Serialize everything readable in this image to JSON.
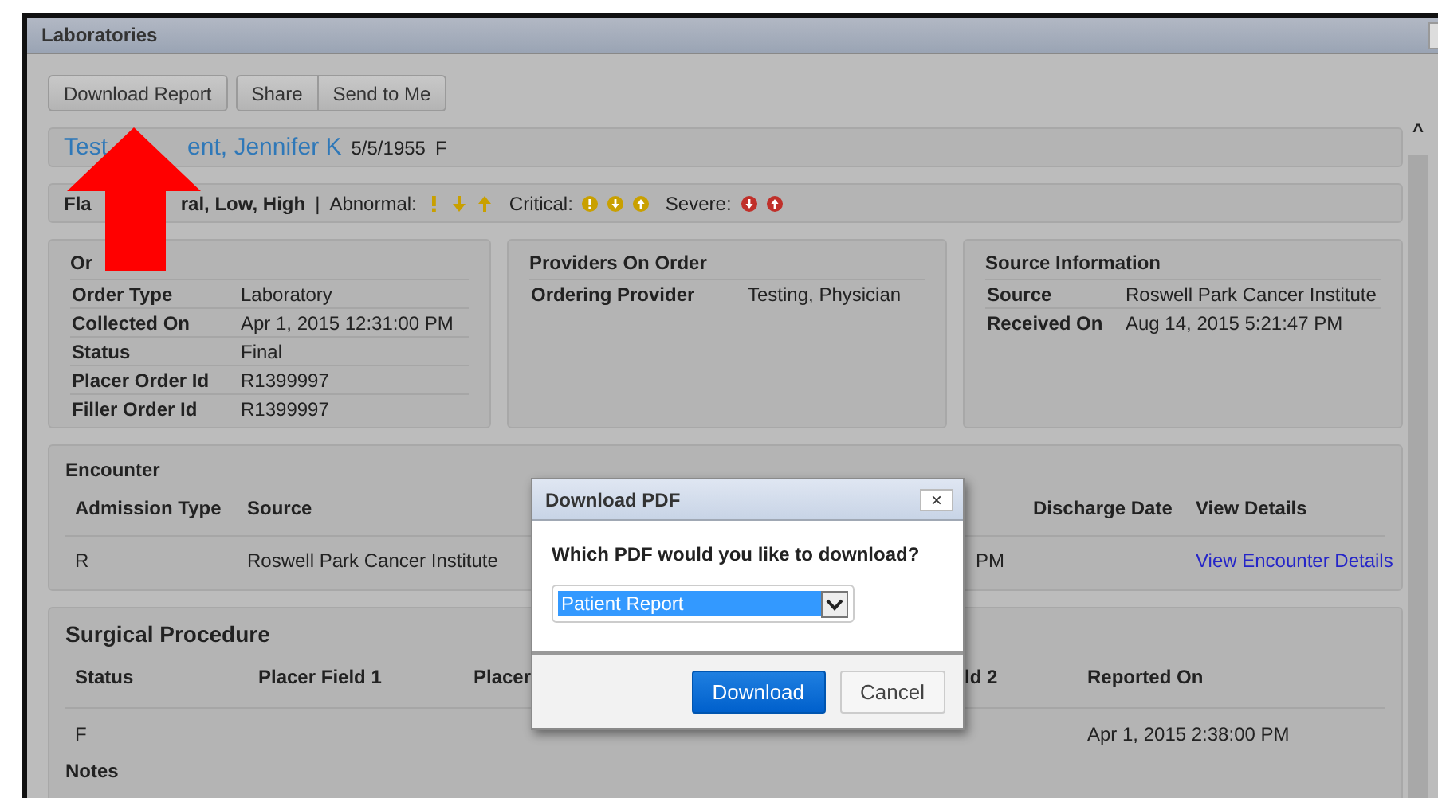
{
  "window": {
    "title": "Laboratories"
  },
  "toolbar": {
    "buttons": [
      "Download Report",
      "Share",
      "Send to Me"
    ]
  },
  "patient": {
    "name_parts": [
      "Test",
      "ent, Jennifer K"
    ],
    "birth_date": "5/5/1955",
    "sex": "F"
  },
  "legend": {
    "flags_parts": [
      "Fla",
      "ral, Low, High"
    ],
    "separator": "|",
    "groups": [
      {
        "label": "Abnormal:",
        "icons": [
          {
            "kind": "bang",
            "color": "#c9a000"
          },
          {
            "kind": "down",
            "color": "#c9a000"
          },
          {
            "kind": "up",
            "color": "#c9a000"
          }
        ]
      },
      {
        "label": "Critical:",
        "icons": [
          {
            "kind": "circle-bang",
            "color": "#c9a000"
          },
          {
            "kind": "circle-down",
            "color": "#c9a000"
          },
          {
            "kind": "circle-up",
            "color": "#c9a000"
          }
        ]
      },
      {
        "label": "Severe:",
        "icons": [
          {
            "kind": "circle-down",
            "color": "#c0302a"
          },
          {
            "kind": "circle-up",
            "color": "#c0302a"
          }
        ]
      }
    ]
  },
  "cards": [
    {
      "title": "Or",
      "rows": [
        {
          "label": "Order Type",
          "value": "Laboratory"
        },
        {
          "label": "Collected On",
          "value": "Apr 1, 2015 12:31:00 PM"
        },
        {
          "label": "Status",
          "value": "Final"
        },
        {
          "label": "Placer Order Id",
          "value": "R1399997"
        },
        {
          "label": "Filler Order Id",
          "value": "R1399997"
        }
      ]
    },
    {
      "title": "Providers On Order",
      "rows": [
        {
          "label": "Ordering Provider",
          "value": "Testing, Physician"
        }
      ]
    },
    {
      "title": "Source Information",
      "rows": [
        {
          "label": "Source",
          "value": "Roswell Park Cancer Institute"
        },
        {
          "label": "Received On",
          "value": "Aug 14, 2015 5:21:47 PM"
        }
      ]
    }
  ],
  "encounter": {
    "title": "Encounter",
    "columns": [
      "Admission Type",
      "Source",
      "Discharge Date",
      "View Details"
    ],
    "row": {
      "admission_type": "R",
      "source": "Roswell Park Cancer Institute",
      "time_tail": "PM",
      "link": "View Encounter Details"
    }
  },
  "surgical": {
    "title": "Surgical Procedure",
    "columns": [
      "Status",
      "Placer Field 1",
      "Placer",
      "ld 2",
      "Reported On"
    ],
    "row": {
      "status": "F",
      "reported_on": "Apr 1, 2015 2:38:00 PM"
    },
    "notes": "Notes"
  },
  "dialog": {
    "title": "Download PDF",
    "close": "×",
    "question": "Which PDF would you like to download?",
    "select": {
      "value": "Patient Report"
    },
    "buttons": [
      {
        "label": "Download",
        "primary": true
      },
      {
        "label": "Cancel",
        "primary": false
      }
    ]
  },
  "scrollbar_up": "^"
}
